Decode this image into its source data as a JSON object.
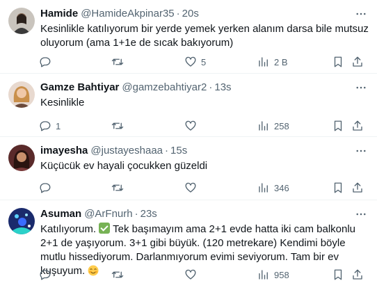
{
  "tweets": [
    {
      "name": "Hamide",
      "handle": "@HamideAkpinar35",
      "time": "20s",
      "text": "Kesinlikle katılıyorum bir yerde yemek yerken alanım darsa bile mutsuz oluyorum (ama 1+1e de sıcak bakıyorum)",
      "replies": "",
      "reposts": "",
      "likes": "5",
      "views": "2 B"
    },
    {
      "name": "Gamze Bahtiyar",
      "handle": "@gamzebahtiyar2",
      "time": "13s",
      "text": "Kesinlikle",
      "replies": "1",
      "reposts": "",
      "likes": "",
      "views": "258"
    },
    {
      "name": "imayesha",
      "handle": "@justayeshaaa",
      "time": "15s",
      "text": "Küçücük ev hayali çocukken güzeldi",
      "replies": "",
      "reposts": "",
      "likes": "",
      "views": "346"
    },
    {
      "name": "Asuman",
      "handle": "@ArFnurh",
      "time": "23s",
      "text_part1": "Katılıyorum.",
      "text_part2": " Tek başımayım ama 2+1 evde hatta iki cam balkonlu 2+1 de yaşıyorum. 3+1 gibi büyük. (120 metrekare) Kendimi böyle mutlu hissediyorum. Darlanmıyorum evimi seviyorum. Tam bir ev kuşuyum. ",
      "replies": "",
      "reposts": "",
      "likes": "",
      "views": "958"
    }
  ],
  "separator": "·",
  "icons": {
    "reply": "reply-icon",
    "repost": "repost-icon",
    "like": "heart-icon",
    "views": "views-icon",
    "bookmark": "bookmark-icon",
    "share": "share-icon",
    "more": "more-icon"
  },
  "colors": {
    "text": "#0f1419",
    "secondary": "#536471",
    "border": "#eff3f4"
  }
}
